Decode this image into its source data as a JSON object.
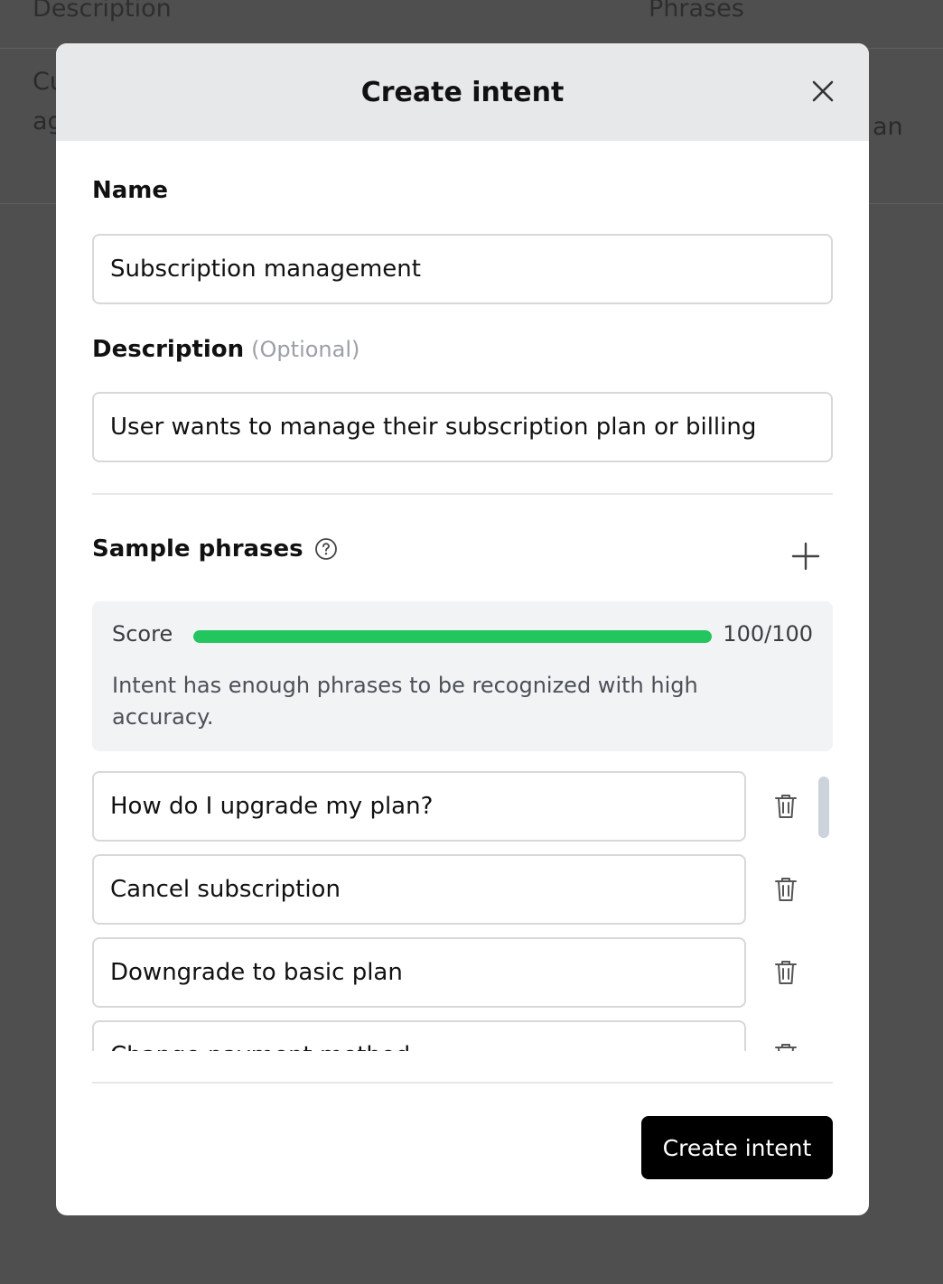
{
  "background": {
    "columns": [
      "Description",
      "Phrases"
    ],
    "row_left_fragments": [
      "Cu",
      "ag"
    ],
    "row_right_fragment": "an"
  },
  "modal": {
    "title": "Create intent",
    "name_label": "Name",
    "name_value": "Subscription management",
    "description_label": "Description",
    "description_optional": "(Optional)",
    "description_value": "User wants to manage their subscription plan or billing",
    "sample_phrases_label": "Sample phrases",
    "score": {
      "label": "Score",
      "value": 100,
      "max": 100,
      "display": "100/100",
      "message": "Intent has enough phrases to be recognized with high accuracy."
    },
    "phrases": [
      "How do I upgrade my plan?",
      "Cancel subscription",
      "Downgrade to basic plan",
      "Change payment method"
    ],
    "submit_label": "Create intent"
  },
  "colors": {
    "overlay": "#4f4f4f",
    "header_bg": "#e7e8ea",
    "score_fill": "#22c55e",
    "primary_button": "#000000"
  },
  "icons": {
    "close": "close-icon",
    "help": "help-circle-icon",
    "add": "plus-icon",
    "delete": "trash-icon"
  }
}
